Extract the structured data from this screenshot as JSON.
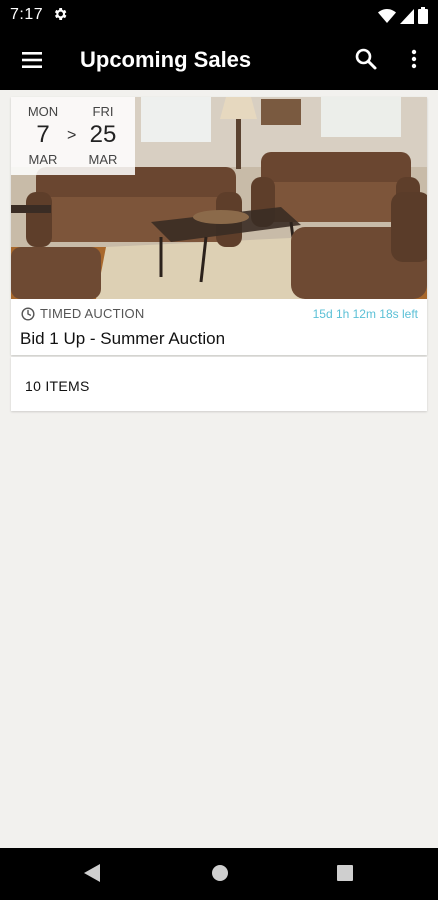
{
  "status": {
    "time": "7:17"
  },
  "appbar": {
    "title": "Upcoming Sales"
  },
  "sale": {
    "start": {
      "dow": "MON",
      "day": "7",
      "mon": "MAR"
    },
    "end": {
      "dow": "FRI",
      "day": "25",
      "mon": "MAR"
    },
    "arrow": ">",
    "type": "TIMED AUCTION",
    "time_left": "15d 1h 12m 18s left",
    "title": "Bid 1 Up - Summer Auction",
    "items": "10 ITEMS"
  },
  "colors": {
    "accent": "#5bc0d6",
    "bar": "#000000",
    "background": "#f2f1ee"
  }
}
